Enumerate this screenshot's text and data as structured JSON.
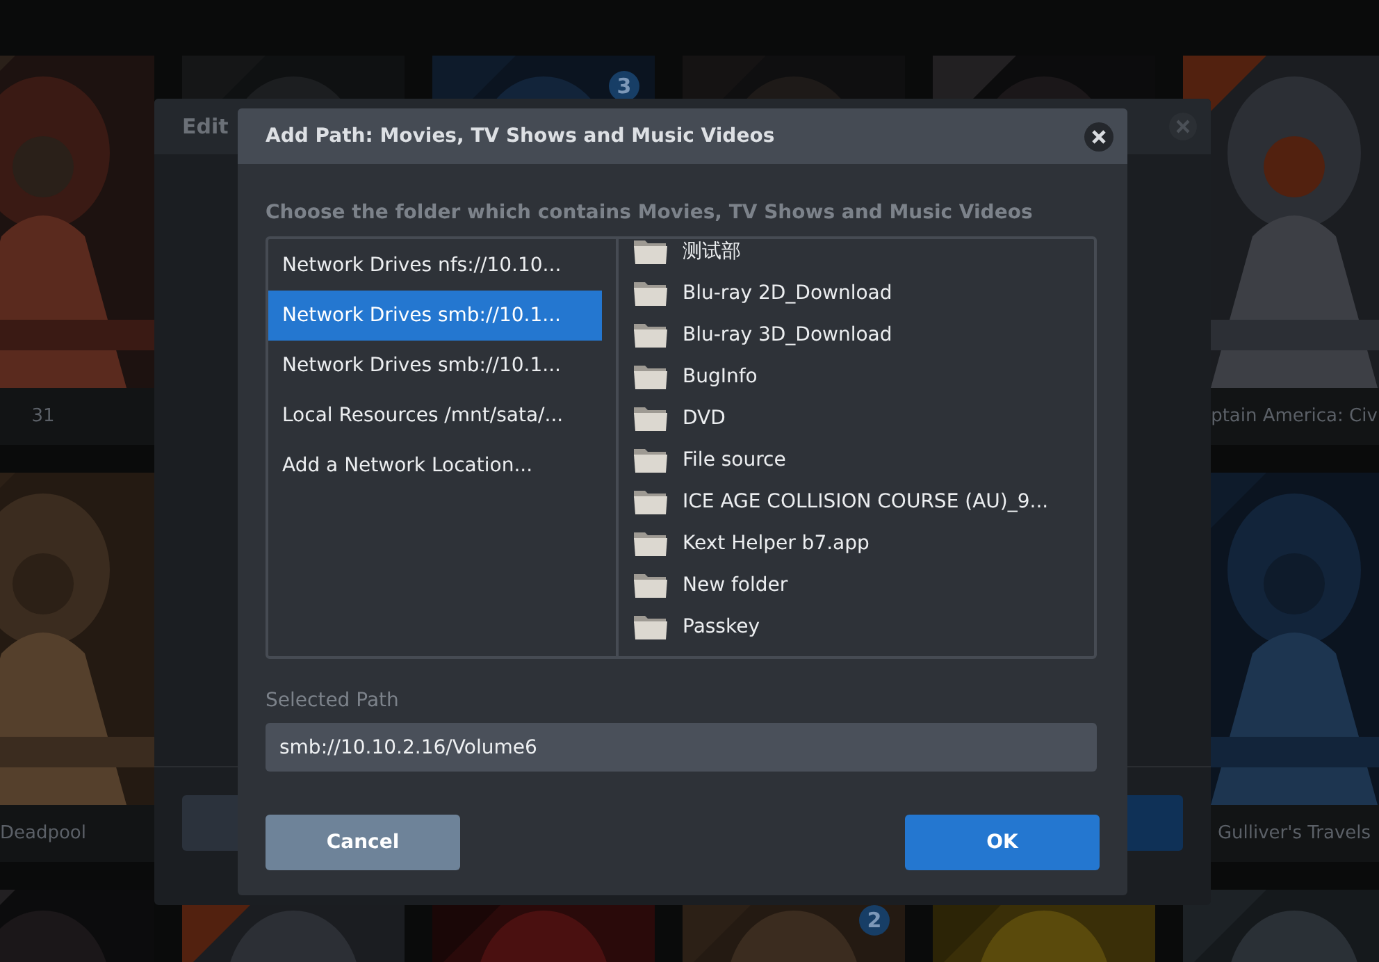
{
  "library": {
    "rows": [
      [
        {
          "kind": "poster",
          "title": "31"
        },
        {
          "kind": "poster"
        },
        {
          "kind": "poster",
          "badge": "3"
        },
        {
          "kind": "poster"
        },
        {
          "kind": "poster"
        },
        {
          "kind": "poster",
          "title": "ptain America: Civ"
        }
      ],
      [
        {
          "kind": "poster",
          "title": "Deadpool"
        },
        {
          "kind": "covered"
        },
        {
          "kind": "covered"
        },
        {
          "kind": "covered"
        },
        {
          "kind": "covered"
        },
        {
          "kind": "poster",
          "title": "Gulliver's Travels"
        }
      ],
      [
        {
          "kind": "poster"
        },
        {
          "kind": "poster"
        },
        {
          "kind": "poster"
        },
        {
          "kind": "poster",
          "badge": "2"
        },
        {
          "kind": "poster"
        },
        {
          "kind": "poster"
        }
      ]
    ]
  },
  "back_dialog": {
    "title": "Edit"
  },
  "dialog": {
    "title": "Add Path: Movies, TV Shows and Music Videos",
    "instruction": "Choose the folder which contains Movies, TV Shows and Music Videos",
    "locations": [
      {
        "label": "Network Drives nfs://10.10...",
        "selected": false
      },
      {
        "label": "Network Drives smb://10.1...",
        "selected": true
      },
      {
        "label": "Network Drives smb://10.1...",
        "selected": false
      },
      {
        "label": "Local Resources /mnt/sata/...",
        "selected": false
      },
      {
        "label": "Add a Network Location...",
        "selected": false
      }
    ],
    "folders": [
      "测试部",
      "Blu-ray 2D_Download",
      "Blu-ray 3D_Download",
      "BugInfo",
      "DVD",
      "File source",
      "ICE AGE COLLISION COURSE (AU)_9...",
      "Kext Helper b7.app",
      "New folder",
      "Passkey"
    ],
    "selected_path_label": "Selected Path",
    "selected_path": "smb://10.10.2.16/Volume6",
    "buttons": [
      {
        "label": "Cancel",
        "kind": "secondary"
      },
      {
        "label": "OK",
        "kind": "primary"
      }
    ]
  }
}
